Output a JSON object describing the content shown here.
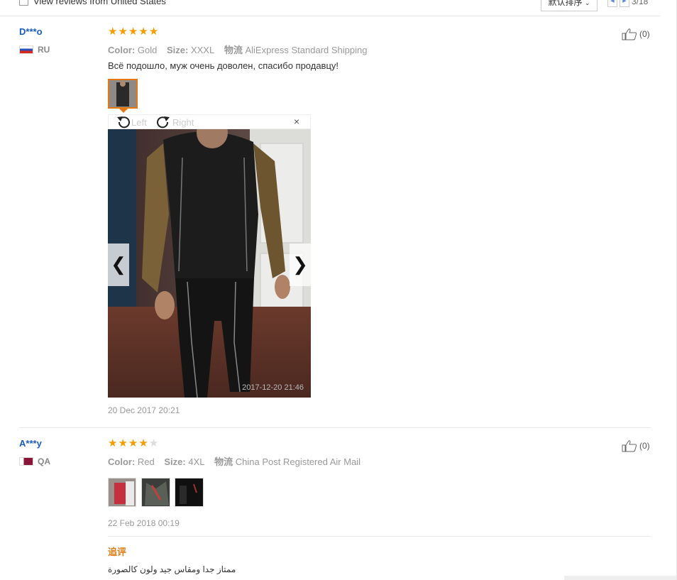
{
  "filter": {
    "label": "View reviews from United States"
  },
  "sort": {
    "label": "默认排序"
  },
  "pager": {
    "text": "3/18"
  },
  "reviews": [
    {
      "user": "D***o",
      "country": "RU",
      "rating": 5,
      "color_label": "Color:",
      "color": "Gold",
      "size_label": "Size:",
      "size": "XXXL",
      "shipping_label": "物流",
      "shipping": "AliExpress Standard Shipping",
      "text": "Всё подошло, муж очень доволен, спасибо продавцу!",
      "likes": "(0)",
      "date": "20 Dec 2017 20:21",
      "viewer": {
        "rotate_left": "Left",
        "rotate_right": "Right",
        "close": "×",
        "watermark": "2017-12-20 21:46"
      }
    },
    {
      "user": "A***y",
      "country": "QA",
      "rating": 4,
      "color_label": "Color:",
      "color": "Red",
      "size_label": "Size:",
      "size": "4XL",
      "shipping_label": "物流",
      "shipping": "China Post Registered Air Mail",
      "likes": "(0)",
      "date": "22 Feb 2018 00:19",
      "additional_label": "追评",
      "additional_text": "ممتاز جدا ومقاس جيد ولون كالصورة"
    }
  ],
  "colors": {
    "accent": "#e47911",
    "star": "#f59d00",
    "link": "#1b5bbf"
  }
}
